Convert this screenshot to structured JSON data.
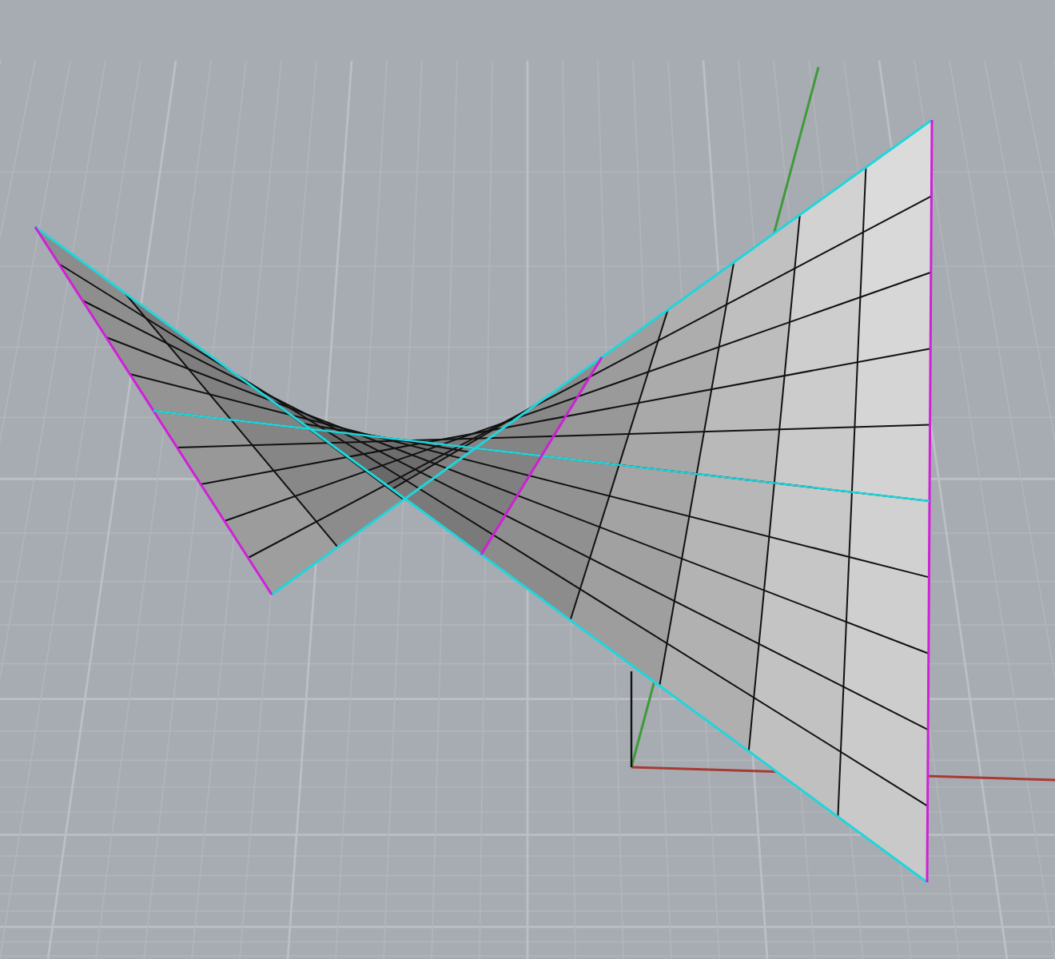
{
  "viewport": {
    "kind": "perspective",
    "grid": true,
    "axes": true,
    "surface": {
      "kind": "saddle",
      "edges_highlighted": true
    }
  }
}
